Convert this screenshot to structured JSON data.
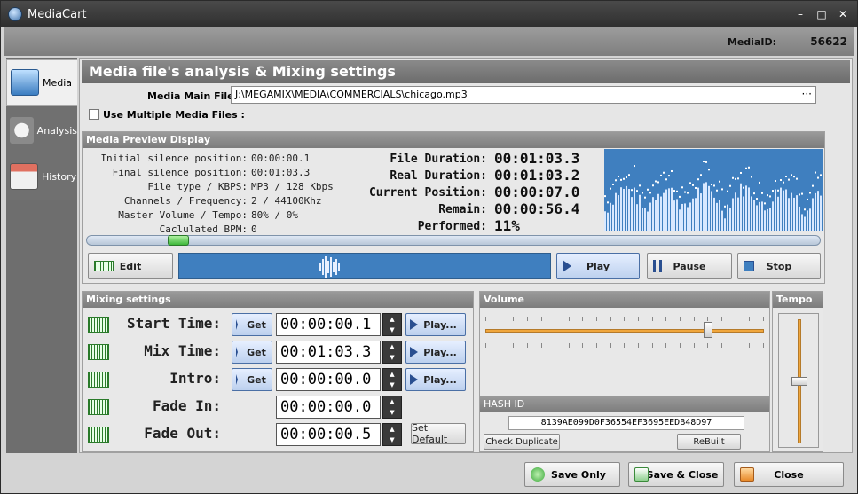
{
  "window": {
    "title": "MediaCart",
    "minimize": "–",
    "maximize": "□",
    "close": "✕"
  },
  "idbar": {
    "label": "MediaID:",
    "value": "56622"
  },
  "sidebar": {
    "items": [
      {
        "label": "Media",
        "icon": "media-icon",
        "active": true
      },
      {
        "label": "Analysis",
        "icon": "analysis-icon",
        "active": false
      },
      {
        "label": "History",
        "icon": "history-icon",
        "active": false
      }
    ]
  },
  "main": {
    "title": "Media file's analysis & Mixing settings",
    "file_label": "Media Main File :",
    "file_value": "J:\\MEGAMIX\\MEDIA\\COMMERCIALS\\chicago.mp3",
    "browse": "···",
    "multi_label": "Use Multiple Media Files :"
  },
  "preview": {
    "title": "Media Preview Display",
    "info": [
      {
        "label": "Initial silence position:",
        "value": "00:00:00.1"
      },
      {
        "label": "Final silence position:",
        "value": "00:01:03.3"
      },
      {
        "label": "File type / KBPS:",
        "value": "MP3 / 128 Kbps"
      },
      {
        "label": "Channels / Frequency:",
        "value": "2 / 44100Khz"
      },
      {
        "label": "Master Volume / Tempo:",
        "value": "80% / 0%"
      },
      {
        "label": "Caclulated BPM:",
        "value": "0"
      }
    ],
    "durations": [
      {
        "label": "File Duration:",
        "value": "00:01:03.3"
      },
      {
        "label": "Real Duration:",
        "value": "00:01:03.2"
      },
      {
        "label": "Current Position:",
        "value": "00:00:07.0"
      },
      {
        "label": "Remain:",
        "value": "00:00:56.4"
      },
      {
        "label": "Performed:",
        "value": "11%"
      }
    ],
    "seek_fraction": 0.11,
    "buttons": {
      "edit": "Edit",
      "play": "Play",
      "pause": "Pause",
      "stop": "Stop"
    }
  },
  "mixing": {
    "title": "Mixing settings",
    "rows": [
      {
        "label": "Start Time:",
        "value": "00:00:00.1",
        "get": "Get",
        "play": "Play..."
      },
      {
        "label": "Mix Time:",
        "value": "00:01:03.3",
        "get": "Get",
        "play": "Play..."
      },
      {
        "label": "Intro:",
        "value": "00:00:00.0",
        "get": "Get",
        "play": "Play..."
      },
      {
        "label": "Fade In:",
        "value": "00:00:00.0"
      },
      {
        "label": "Fade Out:",
        "value": "00:00:00.5"
      }
    ],
    "set_default": "Set Default"
  },
  "volume": {
    "title": "Volume",
    "level": 0.8
  },
  "hash": {
    "title": "HASH ID",
    "value": "8139AE099D0F36554EF3695EEDB48D97",
    "check": "Check Duplicate",
    "rebuilt": "ReBuilt"
  },
  "tempo": {
    "title": "Tempo",
    "level": 0.5
  },
  "footer": {
    "save_only": "Save Only",
    "save_close": "Save & Close",
    "close": "Close"
  },
  "colors": {
    "accent_orange": "#f0a63c",
    "wave_blue": "#3f7fbf",
    "header_gray": "#7c7c7c"
  }
}
